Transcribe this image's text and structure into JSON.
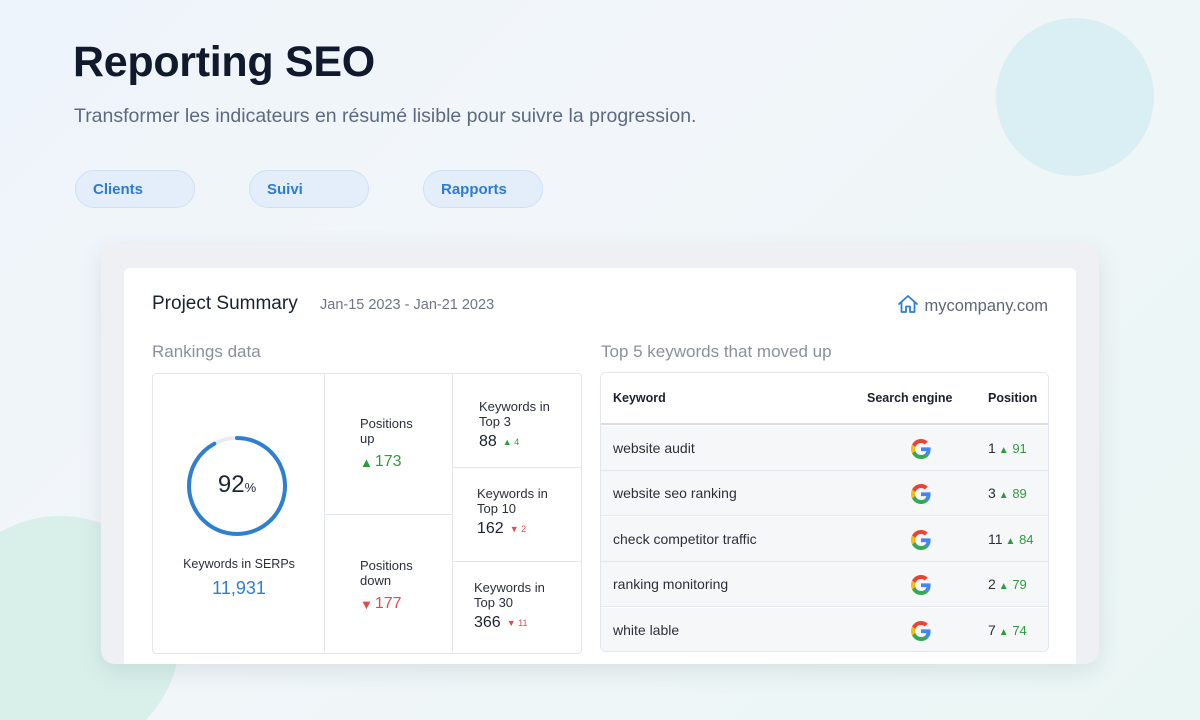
{
  "header": {
    "title": "Reporting SEO",
    "subtitle": "Transformer les indicateurs en résumé lisible pour suivre la progression."
  },
  "nav_pills": [
    "Clients",
    "Suivi",
    "Rapports"
  ],
  "summary": {
    "title": "Project Summary",
    "date_range": "Jan-15 2023 - Jan-21 2023",
    "domain": "mycompany.com",
    "domain_icon": "home-icon"
  },
  "rankings": {
    "section_label": "Rankings data",
    "serps": {
      "percent": "92",
      "percent_symbol": "%",
      "percent_value": 0.92,
      "label": "Keywords in SERPs",
      "value": "11,931"
    },
    "positions_up": {
      "label": "Positions up",
      "arrow": "▲",
      "value": "173"
    },
    "positions_down": {
      "label": "Positions down",
      "arrow": "▼",
      "value": "177"
    },
    "top3": {
      "label": "Keywords in Top 3",
      "value": "88",
      "arrow": "▲",
      "delta": "4"
    },
    "top10": {
      "label": "Keywords in Top 10",
      "value": "162",
      "arrow": "▼",
      "delta": "2"
    },
    "top30": {
      "label": "Keywords in Top 30",
      "value": "366",
      "arrow": "▼",
      "delta": "11"
    }
  },
  "keywords": {
    "section_label": "Top 5 keywords that moved up",
    "columns": [
      "Keyword",
      "Search engine",
      "Position"
    ],
    "rows": [
      {
        "keyword": "website audit",
        "engine": "google-icon",
        "position": "1",
        "arrow": "▲",
        "delta": "91"
      },
      {
        "keyword": "website seo ranking",
        "engine": "google-icon",
        "position": "3",
        "arrow": "▲",
        "delta": "89"
      },
      {
        "keyword": "check competitor traffic",
        "engine": "google-icon",
        "position": "11",
        "arrow": "▲",
        "delta": "84"
      },
      {
        "keyword": "ranking monitoring",
        "engine": "google-icon",
        "position": "2",
        "arrow": "▲",
        "delta": "79"
      },
      {
        "keyword": "white lable",
        "engine": "google-icon",
        "position": "7",
        "arrow": "▲",
        "delta": "74"
      }
    ]
  },
  "colors": {
    "accent_blue": "#2f7fd1",
    "up_green": "#2f9a3c",
    "down_red": "#e04b4b",
    "ring_track": "#e8ecf1"
  }
}
